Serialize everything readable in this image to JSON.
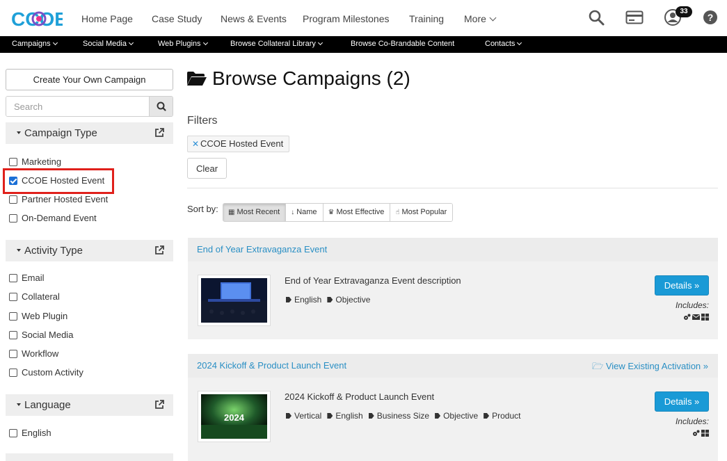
{
  "nav": {
    "logo_text": "CCOE",
    "links": [
      "Home Page",
      "Case Study",
      "News & Events",
      "Program Milestones",
      "Training",
      "More"
    ],
    "notification_count": "33"
  },
  "subnav": {
    "items": [
      "Campaigns",
      "Social Media",
      "Web Plugins",
      "Browse Collateral Library",
      "Browse Co-Brandable Content",
      "Contacts"
    ]
  },
  "sidebar": {
    "create_button": "Create Your Own Campaign",
    "search_placeholder": "Search",
    "facets": [
      {
        "title": "Campaign Type",
        "options": [
          {
            "label": "Marketing",
            "checked": false
          },
          {
            "label": "CCOE Hosted Event",
            "checked": true
          },
          {
            "label": "Partner Hosted Event",
            "checked": false
          },
          {
            "label": "On-Demand Event",
            "checked": false
          }
        ]
      },
      {
        "title": "Activity Type",
        "options": [
          {
            "label": "Email",
            "checked": false
          },
          {
            "label": "Collateral",
            "checked": false
          },
          {
            "label": "Web Plugin",
            "checked": false
          },
          {
            "label": "Social Media",
            "checked": false
          },
          {
            "label": "Workflow",
            "checked": false
          },
          {
            "label": "Custom Activity",
            "checked": false
          }
        ]
      },
      {
        "title": "Language",
        "options": [
          {
            "label": "English",
            "checked": false
          }
        ]
      }
    ]
  },
  "main": {
    "title": "Browse Campaigns (2)",
    "filters_label": "Filters",
    "active_filter": "CCOE Hosted Event",
    "clear_button": "Clear",
    "sort_label": "Sort by:",
    "sort_options": [
      {
        "label": "Most Recent",
        "icon": "calendar-icon",
        "active": true
      },
      {
        "label": "Name",
        "icon": "sort-alpha-icon",
        "active": false
      },
      {
        "label": "Most Effective",
        "icon": "trophy-icon",
        "active": false
      },
      {
        "label": "Most Popular",
        "icon": "thumbs-up-icon",
        "active": false
      }
    ],
    "campaigns": [
      {
        "title": "End of Year Extravaganza Event",
        "link": "",
        "description": "End of Year Extravaganza Event description",
        "tags": [
          "English",
          "Objective"
        ],
        "details_button": "Details »",
        "includes_label": "Includes:",
        "includes_icons": [
          "gears-icon",
          "envelope-icon",
          "grid-icon"
        ]
      },
      {
        "title": "2024 Kickoff & Product Launch Event",
        "link": "View Existing Activation »",
        "description": "2024 Kickoff & Product Launch Event",
        "thumb_text": "2024",
        "tags": [
          "Vertical",
          "English",
          "Business Size",
          "Objective",
          "Product"
        ],
        "details_button": "Details »",
        "includes_label": "Includes:",
        "includes_icons": [
          "gears-icon",
          "grid-icon"
        ]
      }
    ]
  },
  "colors": {
    "accent": "#1a9ad6",
    "link": "#2a8fc4",
    "highlight": "#e0201b"
  }
}
